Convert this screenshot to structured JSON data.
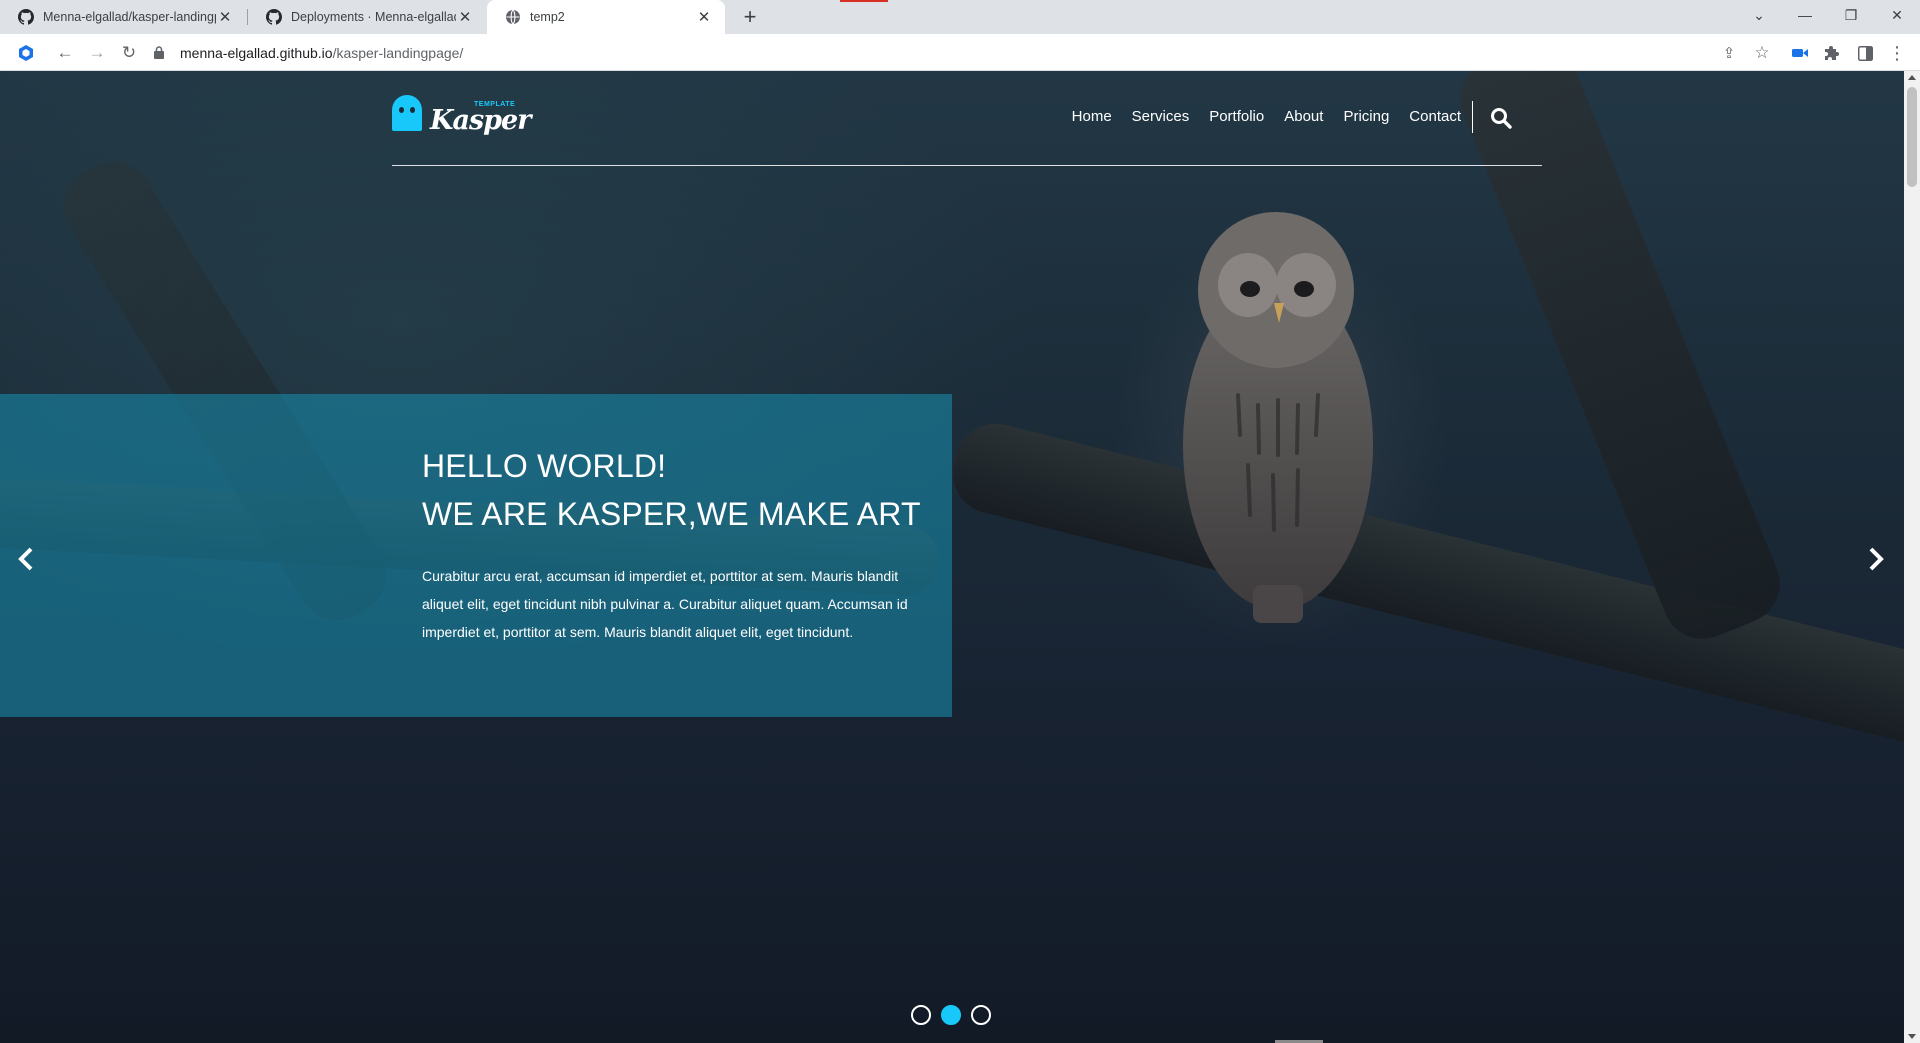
{
  "browser": {
    "tabs": [
      {
        "title": "Menna-elgallad/kasper-landingp",
        "icon": "github-icon"
      },
      {
        "title": "Deployments · Menna-elgallad/k",
        "icon": "github-icon"
      },
      {
        "title": "temp2",
        "icon": "globe-icon"
      }
    ],
    "address": {
      "host": "menna-elgallad.github.io",
      "path": "/kasper-landingpage/"
    }
  },
  "site": {
    "logo": {
      "word": "Kasper",
      "tag": "TEMPLATE"
    },
    "nav": [
      "Home",
      "Services",
      "Portfolio",
      "About",
      "Pricing",
      "Contact"
    ],
    "hero": {
      "line1": "HELLO WORLD!",
      "line2": "WE ARE KASPER,WE MAKE ART",
      "text": "Curabitur arcu erat, accumsan id imperdiet et, porttitor at sem. Mauris blandit aliquet elit, eget tincidunt nibh pulvinar a. Curabitur aliquet quam. Accumsan id imperdiet et, porttitor at sem. Mauris blandit aliquet elit, eget tincidunt."
    },
    "slider": {
      "count": 3,
      "active_index": 2
    }
  },
  "colors": {
    "accent": "#19c8fa",
    "hero_box": "#188cac",
    "tab_bar": "#dee1e6"
  }
}
